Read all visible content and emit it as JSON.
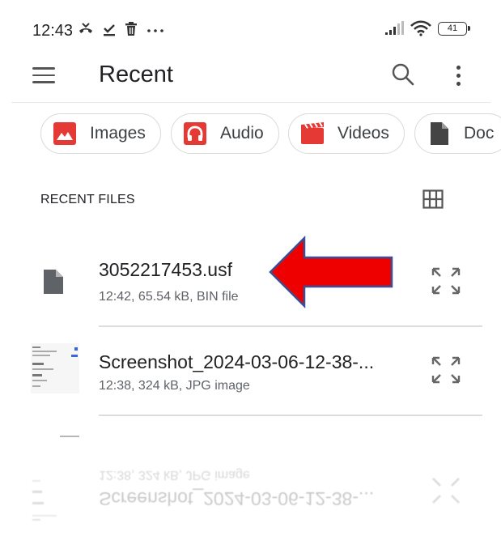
{
  "status_bar": {
    "time": "12:43",
    "battery": "41"
  },
  "app_bar": {
    "title": "Recent"
  },
  "chips": [
    {
      "label": "Images",
      "color": "#e53935"
    },
    {
      "label": "Audio",
      "color": "#e53935"
    },
    {
      "label": "Videos",
      "color": "#e53935"
    },
    {
      "label": "Doc",
      "color": "#444444"
    }
  ],
  "recent_files": {
    "section_title": "RECENT FILES",
    "items": [
      {
        "name": "3052217453.usf",
        "meta": "12:42, 65.54 kB, BIN file"
      },
      {
        "name": "Screenshot_2024-03-06-12-38-...",
        "meta": "12:38, 324 kB, JPG image"
      }
    ]
  },
  "colors": {
    "accent_red": "#e53935",
    "arrow_red": "#ee0000",
    "arrow_outline": "#3a4f9a"
  }
}
